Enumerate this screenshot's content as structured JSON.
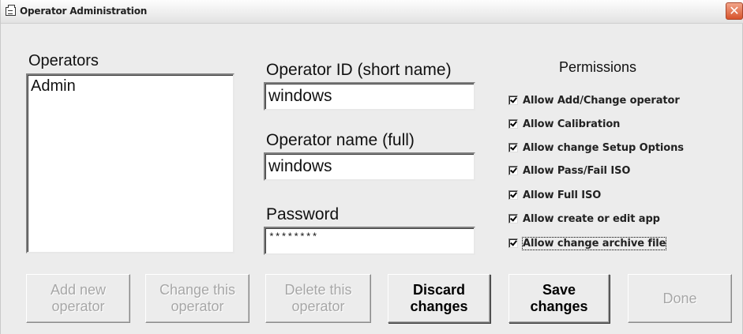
{
  "window": {
    "title": "Operator Administration",
    "close_symbol": "✕"
  },
  "operators": {
    "label": "Operators",
    "items": [
      "Admin"
    ]
  },
  "form": {
    "operator_id_label": "Operator ID (short name)",
    "operator_id_value": "windows",
    "operator_name_label": "Operator name (full)",
    "operator_name_value": "windows",
    "password_label": "Password",
    "password_value": "********"
  },
  "permissions": {
    "heading": "Permissions",
    "items": [
      {
        "label": "Allow Add/Change operator",
        "checked": true
      },
      {
        "label": "Allow Calibration",
        "checked": true
      },
      {
        "label": "Allow change Setup Options",
        "checked": true
      },
      {
        "label": "Allow Pass/Fail ISO",
        "checked": true
      },
      {
        "label": "Allow Full ISO",
        "checked": true
      },
      {
        "label": "Allow create or edit app",
        "checked": true
      },
      {
        "label": "Allow change archive file",
        "checked": true
      }
    ]
  },
  "buttons": {
    "add_new_line1": "Add new",
    "add_new_line2": "operator",
    "change_line1": "Change this",
    "change_line2": "operator",
    "delete_line1": "Delete this",
    "delete_line2": "operator",
    "discard_line1": "Discard",
    "discard_line2": "changes",
    "save_line1": "Save",
    "save_line2": "changes",
    "done": "Done"
  },
  "icons": {
    "window_icon": "window-app-icon",
    "close_icon": "close-icon"
  }
}
